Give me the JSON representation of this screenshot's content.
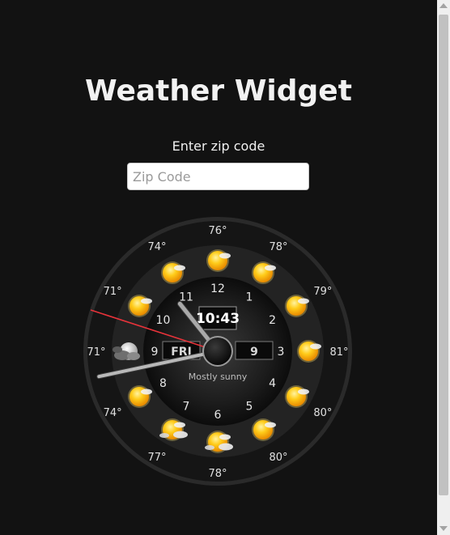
{
  "page": {
    "title": "Weather Widget",
    "zip_label": "Enter zip code",
    "zip_placeholder": "Zip Code",
    "zip_value": ""
  },
  "clock": {
    "time": "10:43",
    "day": "FRI",
    "date": "9",
    "condition": "Mostly sunny",
    "numbers": [
      "12",
      "1",
      "2",
      "3",
      "4",
      "5",
      "6",
      "7",
      "8",
      "9",
      "10",
      "11"
    ],
    "hourly": [
      {
        "hour": "12",
        "temp": "76°",
        "icon": "sun-icon"
      },
      {
        "hour": "1",
        "temp": "78°",
        "icon": "sun-icon"
      },
      {
        "hour": "2",
        "temp": "79°",
        "icon": "sun-icon"
      },
      {
        "hour": "3",
        "temp": "81°",
        "icon": "sun-icon"
      },
      {
        "hour": "4",
        "temp": "80°",
        "icon": "sun-icon"
      },
      {
        "hour": "5",
        "temp": "80°",
        "icon": "sun-icon"
      },
      {
        "hour": "6",
        "temp": "78°",
        "icon": "partly-cloudy-icon"
      },
      {
        "hour": "7",
        "temp": "77°",
        "icon": "partly-cloudy-icon"
      },
      {
        "hour": "8",
        "temp": "74°",
        "icon": "sun-icon"
      },
      {
        "hour": "9",
        "temp": "71°",
        "icon": "cloudy-moon-icon"
      },
      {
        "hour": "10",
        "temp": "71°",
        "icon": "sun-icon"
      },
      {
        "hour": "11",
        "temp": "74°",
        "icon": "sun-icon"
      }
    ],
    "hands": {
      "hour": 10,
      "minute": 43,
      "second": 48
    }
  },
  "colors": {
    "background": "#121212",
    "text": "#f2f2f2",
    "second_hand": "#e8333a",
    "sun": "#f7b500"
  }
}
